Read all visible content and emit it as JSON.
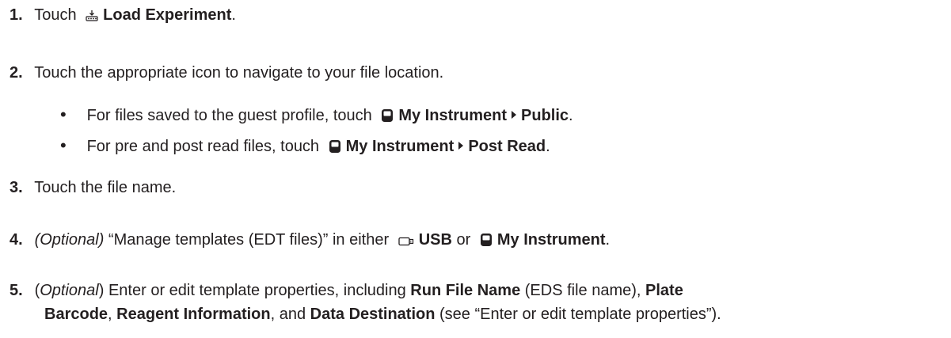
{
  "steps": [
    {
      "num": "1.",
      "pre": "Touch",
      "bold": "Load Experiment",
      "post": "."
    },
    {
      "num": "2.",
      "text": "Touch the appropriate icon to navigate to your file location."
    },
    {
      "num": "3.",
      "text": "Touch the file name."
    },
    {
      "num": "4.",
      "italic": "(Optional)",
      "text": " “Manage templates (EDT files)” in either",
      "usb": "USB",
      "or": "or",
      "instrument": "My Instrument",
      "post": "."
    },
    {
      "num": "5.",
      "open_paren": "(",
      "italic": "Optional",
      "close_paren": ")",
      "text1": " Enter or edit template properties, including ",
      "b1": "Run File Name",
      "text2": " (EDS file name), ",
      "b2": "Plate",
      "b2b": "Barcode",
      "text3": ", ",
      "b3": "Reagent Information",
      "text4": ", and ",
      "b4": "Data Destination",
      "text5": " (see “Enter or edit template properties”)."
    }
  ],
  "bullets": [
    {
      "pre": "For files saved to the guest profile, touch",
      "loc1": "My Instrument",
      "loc2": "Public",
      "post": "."
    },
    {
      "pre": "For pre and post read files, touch",
      "loc1": "My Instrument",
      "loc2": "Post Read",
      "post": "."
    }
  ],
  "icons": {
    "load": "load-experiment-icon",
    "instrument": "my-instrument-icon",
    "usb": "usb-icon"
  }
}
